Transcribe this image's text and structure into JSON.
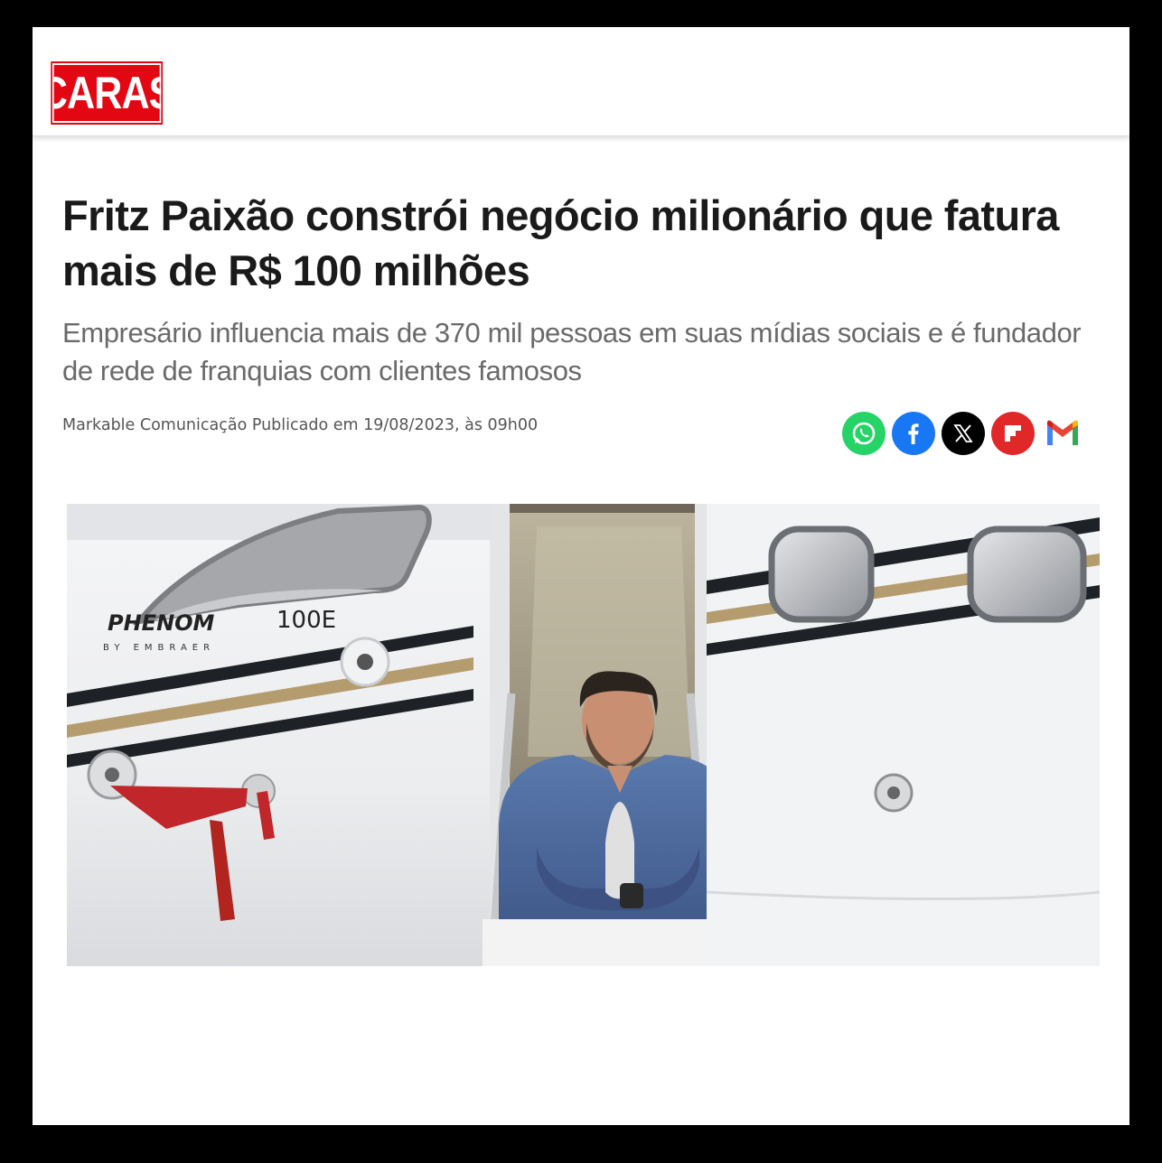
{
  "site": {
    "logo_text": "CARAS",
    "brand_color": "#e30613"
  },
  "article": {
    "headline": "Fritz Paixão constrói negócio milionário que fatura mais de R$ 100 milhões",
    "subtitle": "Empresário influencia mais de 370 mil pessoas em suas mídias sociais e é fundador de rede de franquias com clientes famosos",
    "byline": "Markable Comunicação Publicado em 19/08/2023, às 09h00"
  },
  "share": {
    "buttons": [
      {
        "icon": "whatsapp-icon",
        "color": "#25d366"
      },
      {
        "icon": "facebook-icon",
        "color": "#1877f2"
      },
      {
        "icon": "x-icon",
        "color": "#000000"
      },
      {
        "icon": "flipboard-icon",
        "color": "#e12828"
      },
      {
        "icon": "gmail-icon",
        "color": "#ea4335"
      }
    ]
  },
  "hero_image": {
    "aircraft_model": "PHENOM",
    "aircraft_model_suffix": "100E",
    "aircraft_maker": "BY EMBRAER"
  }
}
